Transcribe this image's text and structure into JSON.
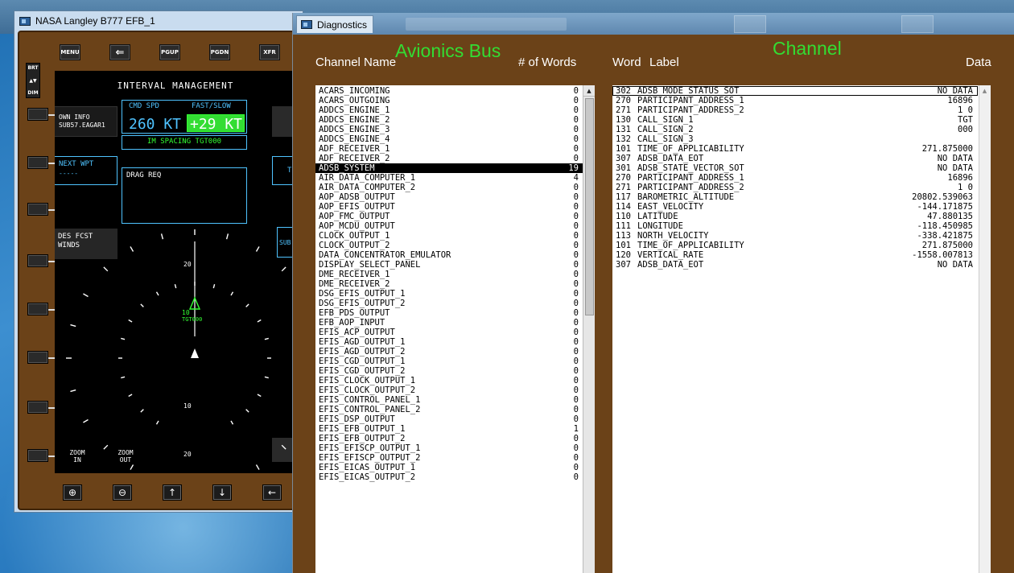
{
  "efb_window": {
    "title": "NASA Langley B777 EFB_1",
    "top_buttons": [
      "MENU",
      "⇐",
      "PGUP",
      "PGDN",
      "XFR"
    ],
    "brightness": {
      "top": "BRT",
      "bottom": "DIM"
    },
    "screen": {
      "title": "INTERVAL MANAGEMENT",
      "cmd_spd_label": "CMD SPD",
      "cmd_spd_value": "260 KT",
      "fast_slow_label": "FAST/SLOW",
      "fast_slow_value": "+29 KT",
      "im_spacing": "IM SPACING TGT000",
      "own_info_label": "OWN INFO",
      "own_info_value": "SUB57.EAGAR1",
      "next_wpt_label": "NEXT WPT",
      "next_wpt_value": "-----",
      "drag_req": "DRAG REQ",
      "des_fcst_label": "DES FCST",
      "des_fcst_value": "WINDS",
      "right_partial_1": "T",
      "right_partial_2": "SUB",
      "range_top": "20",
      "range_mid_top": "10",
      "traffic_label": "10",
      "traffic_id": "TGT000",
      "range_mid_bottom": "10",
      "range_bottom": "20",
      "zoom_in": "ZOOM IN",
      "zoom_out": "ZOOM OUT"
    },
    "bottom_buttons": [
      "zoom-in-glyph",
      "zoom-out-glyph",
      "up-arrow",
      "down-arrow",
      "left-arrow"
    ]
  },
  "diagnostics": {
    "title": "Diagnostics",
    "section_avionics": "Avionics Bus",
    "section_channel": "Channel",
    "col_channel_name": "Channel Name",
    "col_num_words": "# of Words",
    "col_word": "Word",
    "col_label": "Label",
    "col_data": "Data",
    "channels": [
      {
        "name": "ACARS_INCOMING",
        "count": "0"
      },
      {
        "name": "ACARS_OUTGOING",
        "count": "0"
      },
      {
        "name": "ADDCS_ENGINE_1",
        "count": "0"
      },
      {
        "name": "ADDCS_ENGINE_2",
        "count": "0"
      },
      {
        "name": "ADDCS_ENGINE_3",
        "count": "0"
      },
      {
        "name": "ADDCS_ENGINE_4",
        "count": "0"
      },
      {
        "name": "ADF_RECEIVER_1",
        "count": "0"
      },
      {
        "name": "ADF_RECEIVER_2",
        "count": "0"
      },
      {
        "name": "ADSB_SYSTEM",
        "count": "19",
        "selected": true
      },
      {
        "name": "AIR_DATA_COMPUTER_1",
        "count": "4"
      },
      {
        "name": "AIR_DATA_COMPUTER_2",
        "count": "0"
      },
      {
        "name": "AOP_ADSB_OUTPUT",
        "count": "0"
      },
      {
        "name": "AOP_EFIS_OUTPUT",
        "count": "0"
      },
      {
        "name": "AOP_FMC_OUTPUT",
        "count": "0"
      },
      {
        "name": "AOP_MCDU_OUTPUT",
        "count": "0"
      },
      {
        "name": "CLOCK_OUTPUT_1",
        "count": "0"
      },
      {
        "name": "CLOCK_OUTPUT_2",
        "count": "0"
      },
      {
        "name": "DATA_CONCENTRATOR_EMULATOR",
        "count": "0"
      },
      {
        "name": "DISPLAY_SELECT_PANEL",
        "count": "0"
      },
      {
        "name": "DME_RECEIVER_1",
        "count": "0"
      },
      {
        "name": "DME_RECEIVER_2",
        "count": "0"
      },
      {
        "name": "DSG_EFIS_OUTPUT_1",
        "count": "0"
      },
      {
        "name": "DSG_EFIS_OUTPUT_2",
        "count": "0"
      },
      {
        "name": "EFB_PDS_OUTPUT",
        "count": "0"
      },
      {
        "name": "EFB_AOP_INPUT",
        "count": "0"
      },
      {
        "name": "EFIS_ACP_OUTPUT",
        "count": "0"
      },
      {
        "name": "EFIS_AGD_OUTPUT_1",
        "count": "0"
      },
      {
        "name": "EFIS_AGD_OUTPUT_2",
        "count": "0"
      },
      {
        "name": "EFIS_CGD_OUTPUT_1",
        "count": "0"
      },
      {
        "name": "EFIS_CGD_OUTPUT_2",
        "count": "0"
      },
      {
        "name": "EFIS_CLOCK_OUTPUT_1",
        "count": "0"
      },
      {
        "name": "EFIS_CLOCK_OUTPUT_2",
        "count": "0"
      },
      {
        "name": "EFIS_CONTROL_PANEL_1",
        "count": "0"
      },
      {
        "name": "EFIS_CONTROL_PANEL_2",
        "count": "0"
      },
      {
        "name": "EFIS_DSP_OUTPUT",
        "count": "0"
      },
      {
        "name": "EFIS_EFB_OUTPUT_1",
        "count": "1"
      },
      {
        "name": "EFIS_EFB_OUTPUT_2",
        "count": "0"
      },
      {
        "name": "EFIS_EFISCP_OUTPUT_1",
        "count": "0"
      },
      {
        "name": "EFIS_EFISCP_OUTPUT_2",
        "count": "0"
      },
      {
        "name": "EFIS_EICAS_OUTPUT_1",
        "count": "0"
      },
      {
        "name": "EFIS_EICAS_OUTPUT_2",
        "count": "0"
      }
    ],
    "words": [
      {
        "word": "302",
        "label": "ADSB_MODE_STATUS_SOT",
        "data": "NO DATA"
      },
      {
        "word": "270",
        "label": "PARTICIPANT_ADDRESS_1",
        "data": "16896"
      },
      {
        "word": "271",
        "label": "PARTICIPANT_ADDRESS_2",
        "data": "1 0"
      },
      {
        "word": "130",
        "label": "CALL_SIGN_1",
        "data": "TGT"
      },
      {
        "word": "131",
        "label": "CALL_SIGN_2",
        "data": "000"
      },
      {
        "word": "132",
        "label": "CALL_SIGN_3",
        "data": ""
      },
      {
        "word": "101",
        "label": "TIME_OF_APPLICABILITY",
        "data": "271.875000"
      },
      {
        "word": "307",
        "label": "ADSB_DATA_EOT",
        "data": "NO DATA"
      },
      {
        "word": "301",
        "label": "ADSB_STATE_VECTOR_SOT",
        "data": "NO DATA"
      },
      {
        "word": "270",
        "label": "PARTICIPANT_ADDRESS_1",
        "data": "16896"
      },
      {
        "word": "271",
        "label": "PARTICIPANT_ADDRESS_2",
        "data": "1 0"
      },
      {
        "word": "117",
        "label": "BAROMETRIC_ALTITUDE",
        "data": "20802.539063"
      },
      {
        "word": "114",
        "label": "EAST_VELOCITY",
        "data": "-144.171875"
      },
      {
        "word": "110",
        "label": "LATITUDE",
        "data": "47.880135"
      },
      {
        "word": "111",
        "label": "LONGITUDE",
        "data": "-118.450985"
      },
      {
        "word": "113",
        "label": "NORTH_VELOCITY",
        "data": "-338.421875"
      },
      {
        "word": "101",
        "label": "TIME_OF_APPLICABILITY",
        "data": "271.875000"
      },
      {
        "word": "120",
        "label": "VERTICAL_RATE",
        "data": "-1558.007813"
      },
      {
        "word": "307",
        "label": "ADSB_DATA_EOT",
        "data": "NO DATA"
      }
    ]
  }
}
